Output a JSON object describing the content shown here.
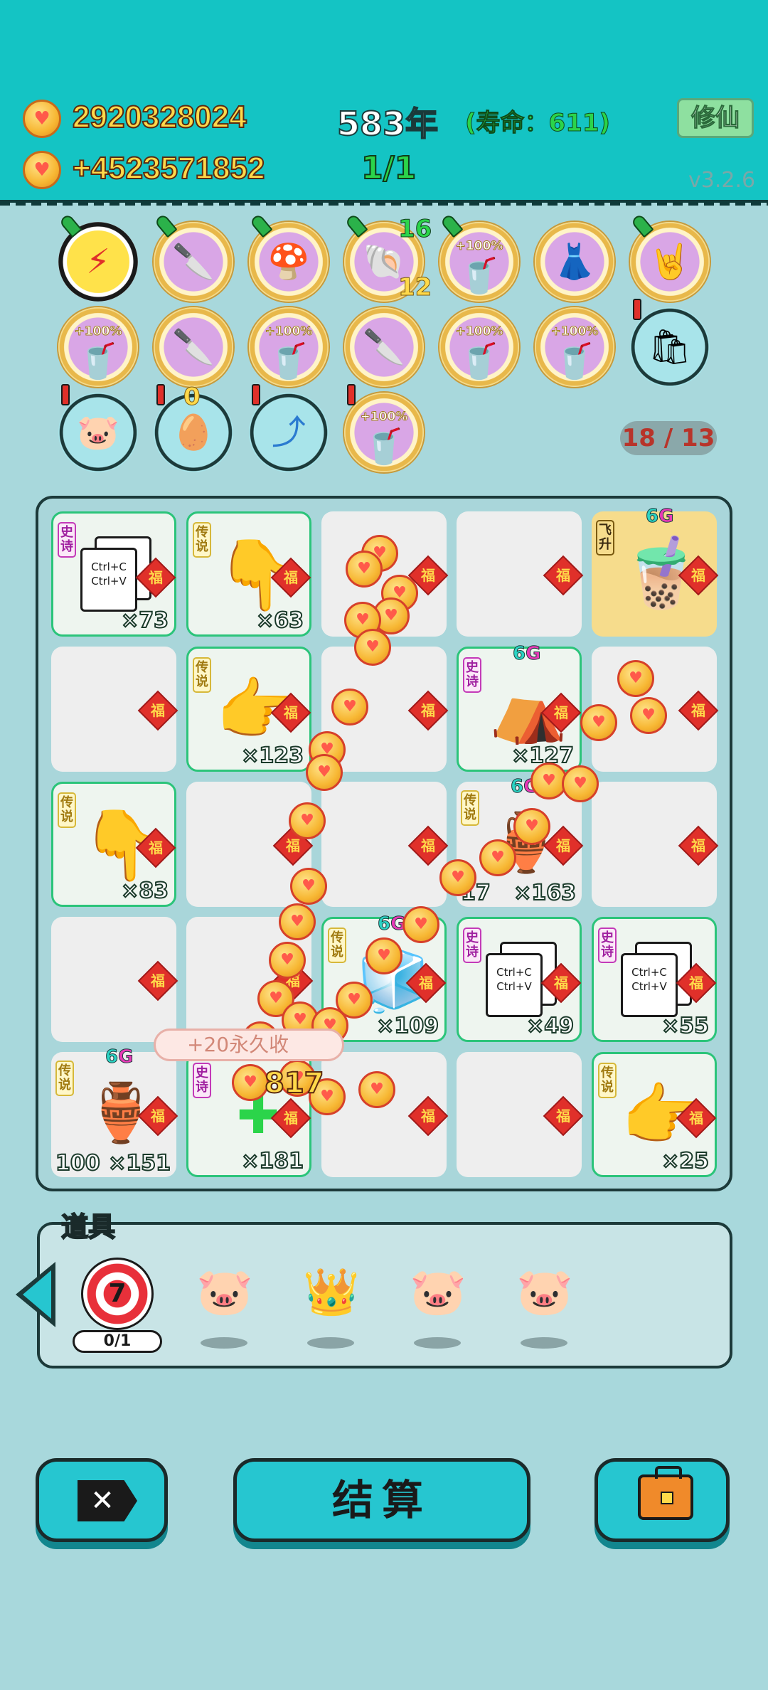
{
  "header": {
    "coins": "2920328024",
    "income": "+4523571852",
    "age": "583年",
    "lifespan": "(寿命：611)",
    "progress": "1/1",
    "cultivate_label": "修仙",
    "version": "v3.2.6"
  },
  "slots": {
    "row1": [
      {
        "icon": "lightning-icon",
        "pinned": true
      },
      {
        "icon": "cleaver-icon",
        "pinned": true
      },
      {
        "icon": "mushroom-cup-icon",
        "pinned": true
      },
      {
        "icon": "shell-icon",
        "pinned": true,
        "count_top": "16",
        "count_bottom": "12"
      },
      {
        "icon": "cup-icon",
        "pinned": true,
        "tag": "+100%"
      },
      {
        "icon": "skirt-icon",
        "pinned": false
      },
      {
        "icon": "rock-hand-icon",
        "pinned": true
      }
    ],
    "row2": [
      {
        "icon": "cup-icon",
        "tag": "+100%"
      },
      {
        "icon": "cleaver-icon"
      },
      {
        "icon": "cup-icon",
        "tag": "+100%"
      },
      {
        "icon": "cleaver-icon"
      },
      {
        "icon": "cup-icon",
        "tag": "+100%"
      },
      {
        "icon": "cup-icon",
        "tag": "+100%"
      },
      {
        "icon": "trash-bag-icon",
        "alert": true
      }
    ],
    "row3": [
      {
        "icon": "piggy-bank-icon",
        "alert": true
      },
      {
        "icon": "egg-tray-icon",
        "alert": true,
        "count": "0"
      },
      {
        "icon": "arrow-card-icon",
        "alert": true
      },
      {
        "icon": "cup-icon",
        "alert": true,
        "tag": "+100%"
      }
    ],
    "ratio": "18 / 13"
  },
  "board": {
    "rarity_chuan": "传说",
    "rarity_shi": "史诗",
    "rarity_fei": "飞升",
    "fu": "福",
    "g6_num": "6",
    "g6_letter": "G",
    "copy_paste": "Ctrl+C Ctrl+V",
    "cells": [
      {
        "mult": "×73"
      },
      {
        "mult": "×63"
      },
      {
        "mult": ""
      },
      {
        "mult": ""
      },
      {
        "mult": ""
      },
      {
        "mult": ""
      },
      {
        "mult": "×123"
      },
      {
        "mult": ""
      },
      {
        "mult": "×127"
      },
      {
        "mult": ""
      },
      {
        "mult": "×83"
      },
      {
        "mult": ""
      },
      {
        "mult": ""
      },
      {
        "mult": "×163",
        "left": "17"
      },
      {
        "mult": ""
      },
      {
        "mult": ""
      },
      {
        "mult": ""
      },
      {
        "mult": "×109"
      },
      {
        "mult": "×49"
      },
      {
        "mult": "×55"
      },
      {
        "mult": "×151",
        "left": "100"
      },
      {
        "mult": "×181"
      },
      {
        "mult": ""
      },
      {
        "mult": ""
      },
      {
        "mult": "×25"
      }
    ],
    "popup": "+20永久收",
    "popup_value": "817"
  },
  "props": {
    "label": "道具",
    "target_value": "7",
    "target_count": "0/1",
    "items": [
      "piggy-bank-icon",
      "crown-icon",
      "piggy-bank-icon",
      "piggy-bank-icon"
    ]
  },
  "buttons": {
    "settle": "结算",
    "close_icon": "close-icon",
    "bag_icon": "briefcase-icon"
  },
  "colors": {
    "accent": "#14c4c4",
    "coin": "#ffd94a",
    "green": "#2bd44a",
    "red": "#e0302a"
  }
}
